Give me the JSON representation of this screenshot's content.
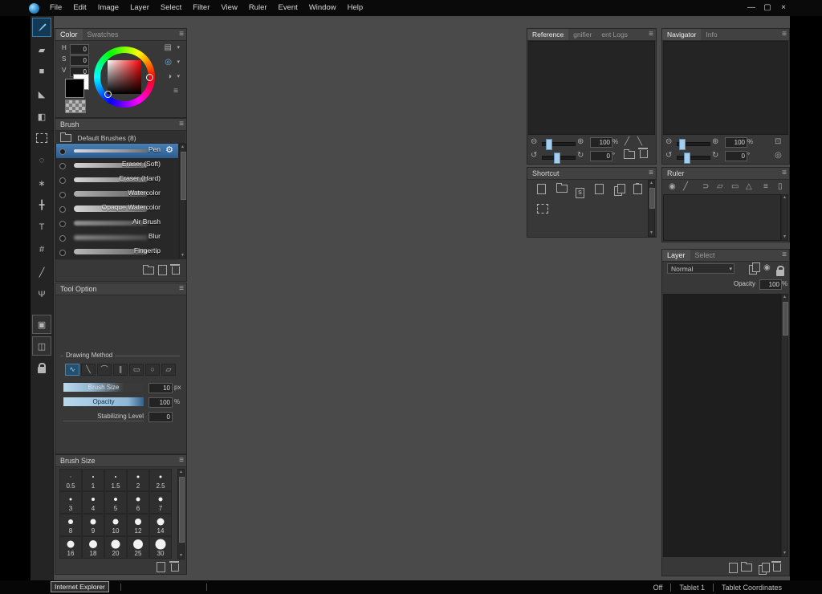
{
  "window": {
    "minimize": "—",
    "maximize": "▢",
    "close": "×"
  },
  "menubar": {
    "items": [
      "File",
      "Edit",
      "Image",
      "Layer",
      "Select",
      "Filter",
      "View",
      "Ruler",
      "Event",
      "Window",
      "Help"
    ]
  },
  "icons": {
    "menu": "≡",
    "dropdown": "▾",
    "zoom_in": "⊕",
    "zoom_out": "⊖",
    "undo": "↺",
    "redo": "↻",
    "gear": "⚙",
    "up": "▲",
    "down": "▼",
    "fit": "⊡",
    "reset": "◎",
    "eyedropper": "╱",
    "pen": "╲"
  },
  "toolbar": {
    "tools": [
      {
        "name": "brush"
      },
      {
        "name": "eraser",
        "glyph": "▰"
      },
      {
        "name": "fill-rect",
        "glyph": "■"
      },
      {
        "name": "bucket",
        "glyph": "◣"
      },
      {
        "name": "gradient",
        "glyph": "◧"
      },
      {
        "name": "select-rect"
      },
      {
        "name": "lasso",
        "glyph": "◌"
      },
      {
        "name": "magic-wand",
        "glyph": "∗"
      },
      {
        "name": "move",
        "glyph": "╋"
      },
      {
        "name": "text",
        "glyph": "T"
      },
      {
        "name": "crop",
        "glyph": "#"
      },
      {
        "name": "eyedropper",
        "glyph": "╱"
      },
      {
        "name": "hand",
        "glyph": "Ψ"
      },
      {
        "name": "panel-toggle-a",
        "glyph": "▣"
      },
      {
        "name": "panel-toggle-b",
        "glyph": "◫"
      },
      {
        "name": "lock"
      }
    ]
  },
  "color_panel": {
    "tabs": [
      "Color",
      "Swatches"
    ],
    "rows": [
      {
        "label": "H",
        "value": "0"
      },
      {
        "label": "S",
        "value": "0"
      },
      {
        "label": "V",
        "value": "0"
      }
    ]
  },
  "brush_panel": {
    "title": "Brush",
    "group": "Default Brushes (8)",
    "brushes": [
      {
        "name": "Pen"
      },
      {
        "name": "Eraser (Soft)"
      },
      {
        "name": "Eraser (Hard)"
      },
      {
        "name": "Watercolor"
      },
      {
        "name": "Opaque Watercolor"
      },
      {
        "name": "Air Brush"
      },
      {
        "name": "Blur"
      },
      {
        "name": "Fingertip"
      }
    ]
  },
  "tool_option": {
    "title": "Tool Option",
    "group": "Drawing Method",
    "methods": [
      "∿",
      "╲",
      "⌒",
      "∥",
      "▭",
      "○",
      "▱"
    ],
    "brush_size_label": "Brush Size",
    "brush_size_value": "10",
    "brush_size_unit": "px",
    "opacity_label": "Opacity",
    "opacity_value": "100",
    "opacity_unit": "%",
    "stabilize_label": "Stabilizing Level",
    "stabilize_value": "0"
  },
  "brush_size_panel": {
    "title": "Brush Size",
    "sizes": [
      "0.5",
      "1",
      "1.5",
      "2",
      "2.5",
      "3",
      "4",
      "5",
      "6",
      "7",
      "8",
      "9",
      "10",
      "12",
      "14",
      "16",
      "18",
      "20",
      "25",
      "30"
    ]
  },
  "reference_panel": {
    "tabs": [
      "Reference",
      "gnifier",
      "ent Logs"
    ],
    "zoom_value": "100",
    "zoom_unit": "%",
    "angle_value": "0",
    "angle_unit": "°"
  },
  "navigator_panel": {
    "tabs": [
      "Navigator",
      "Info"
    ],
    "zoom_value": "100",
    "zoom_unit": "%",
    "angle_value": "0",
    "angle_unit": "°"
  },
  "shortcut_panel": {
    "title": "Shortcut",
    "page_s_label": "S"
  },
  "ruler_panel": {
    "title": "Ruler",
    "icons": [
      "◉",
      "╱",
      "⊃",
      "▱",
      "▭",
      "△",
      "≡",
      "▯"
    ]
  },
  "layer_panel": {
    "tabs": [
      "Layer",
      "Select"
    ],
    "blend_mode": "Normal",
    "opacity_label": "Opacity",
    "opacity_value": "100",
    "opacity_unit": "%"
  },
  "statusbar": {
    "tooltip": "Internet Explorer",
    "items": [
      "Off",
      "Tablet 1",
      "Tablet Coordinates"
    ]
  }
}
